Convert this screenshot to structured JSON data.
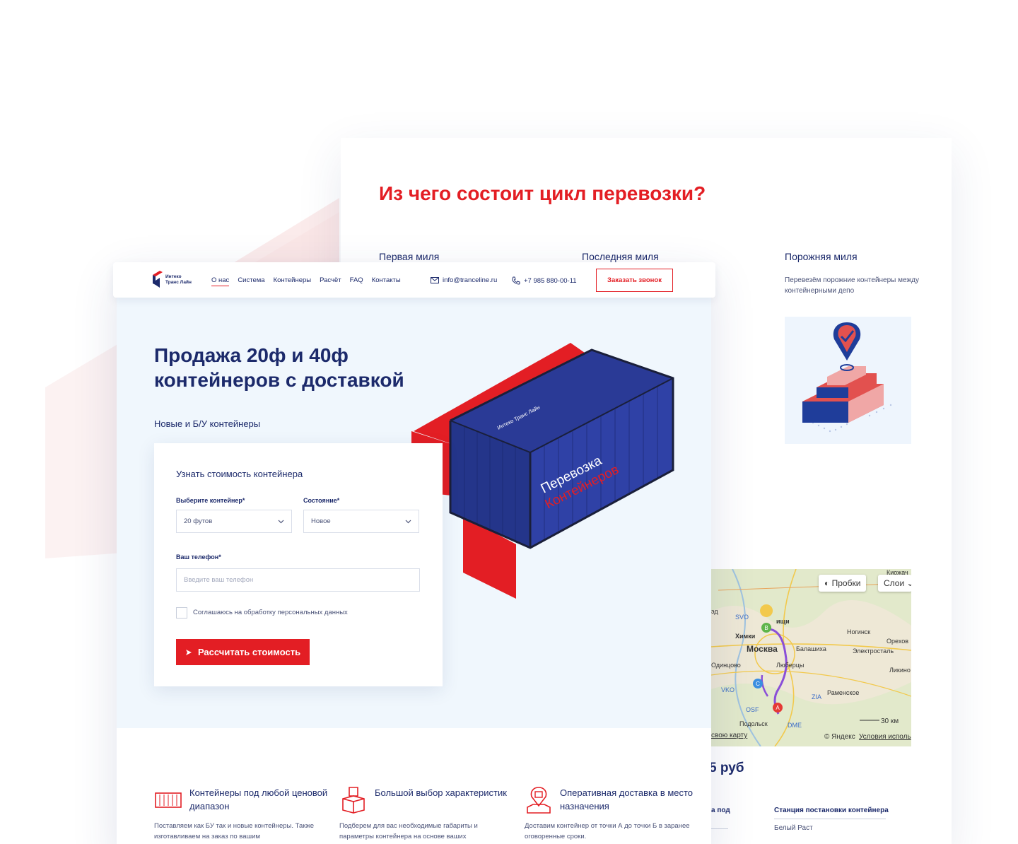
{
  "colors": {
    "brand_red": "#e31e24",
    "brand_navy": "#1c2a6b",
    "hero_bg": "#f0f7fd"
  },
  "back": {
    "title": "Из чего состоит цикл перевозки?",
    "columns": [
      {
        "title": "Первая миля"
      },
      {
        "title": "Последняя миля"
      },
      {
        "title": "Порожняя миля",
        "text": "Перевезём порожние контейнеры между контейнерными депо"
      }
    ],
    "map": {
      "traffic_button": "Пробки",
      "layers_button": "Слои",
      "labels": [
        "Киожач",
        "SVO",
        "Химки",
        "ищи",
        "Ногинск",
        "Орехов",
        "Москва",
        "Балашиха",
        "Электросталь",
        "Одинцово",
        "Люберцы",
        "Ликино",
        "VKO",
        "Раменское",
        "ZIA",
        "OSF",
        "Подольск",
        "DME",
        "эд"
      ],
      "markers": [
        "A",
        "B",
        "C"
      ],
      "scale": "30 км",
      "attribution": "© Яндекс",
      "terms": "Условия исполь",
      "own_map": "свою карту"
    },
    "price_fragment": "5 руб",
    "bottom_left_fragment": "а под",
    "station_label": "Станция постановки контейнера",
    "station_value": "Белый Раст"
  },
  "header": {
    "logo_line1": "Интеко",
    "logo_line2": "Транс Лайн",
    "nav": [
      "О нас",
      "Система",
      "Контейнеры",
      "Расчёт",
      "FAQ",
      "Контакты"
    ],
    "email": "info@tranceline.ru",
    "phone": "+7 985 880-00-11",
    "call_button": "Заказать звонок"
  },
  "hero": {
    "title": "Продажа 20ф и 40ф контейнеров с доставкой",
    "subtitle": "Новые и Б/У контейнеры",
    "container_text": [
      "Интеко Транс Лайн",
      "Перевозка",
      "Контейнеров"
    ]
  },
  "form": {
    "title": "Узнать стоимость контейнера",
    "container_label": "Выберите контейнер*",
    "container_value": "20 футов",
    "state_label": "Состояние*",
    "state_value": "Новое",
    "phone_label": "Ваш телефон*",
    "phone_placeholder": "Введите ваш телефон",
    "consent": "Соглашаюсь на обработку персональных данных",
    "submit": "Рассчитать стоимость"
  },
  "features": [
    {
      "title": "Контейнеры под любой ценовой диапазон",
      "text": "Поставляем как БУ так и новые контейнеры. Также изготавливаем на заказ по вашим",
      "icon": "container-icon"
    },
    {
      "title": "Большой выбор характеристик",
      "text": "Подберем для вас необходимые габариты и параметры контейнера на основе ваших",
      "icon": "boxes-icon"
    },
    {
      "title": "Оперативная доставка в место назначения",
      "text": "Доставим контейнер от точки А до точки Б в заранее оговоренные сроки.",
      "icon": "location-box-icon"
    }
  ]
}
